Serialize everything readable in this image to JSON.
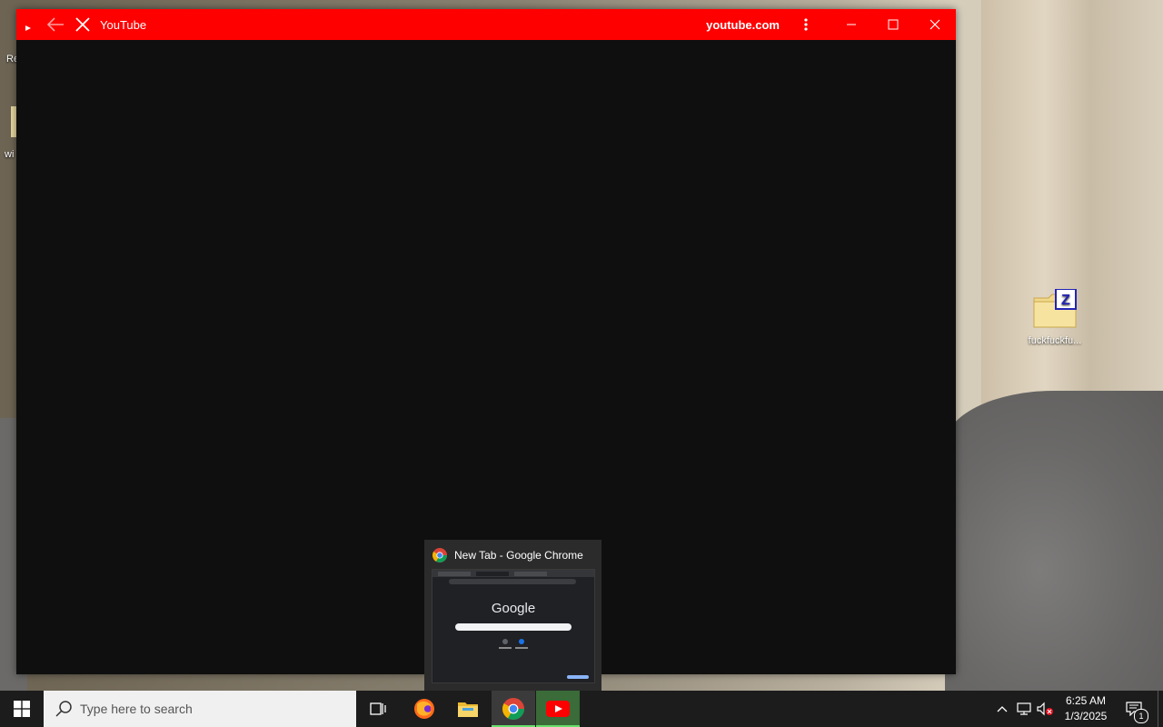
{
  "window": {
    "title": "YouTube",
    "url": "youtube.com",
    "accent_color": "#ff0000",
    "content_color": "#0f0f0f"
  },
  "desktop": {
    "icons": [
      {
        "label": "fuckfuckfu...",
        "icon": "zip-folder-icon"
      }
    ],
    "partial_labels": [
      "Re",
      "wi"
    ]
  },
  "taskbar": {
    "search_placeholder": "Type here to search",
    "apps": [
      "task-view-icon",
      "firefox-icon",
      "file-explorer-icon",
      "chrome-icon",
      "youtube-icon"
    ],
    "clock_time": "6:25 AM",
    "clock_date": "1/3/2025",
    "notification_count": "1"
  },
  "preview": {
    "title": "New Tab - Google Chrome",
    "thumb_logo": "Google"
  }
}
